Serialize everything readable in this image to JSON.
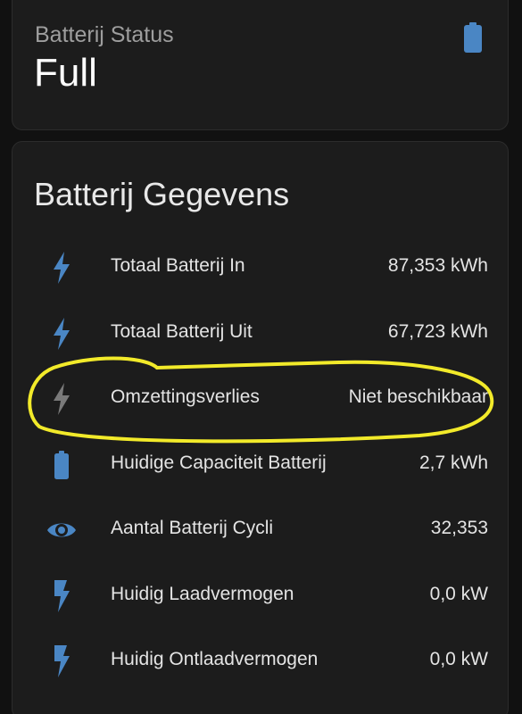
{
  "status_card": {
    "label": "Batterij Status",
    "value": "Full",
    "icon": "battery-icon"
  },
  "details": {
    "title": "Batterij Gegevens",
    "rows": [
      {
        "icon": "lightning-bolt-icon",
        "label": "Totaal Batterij In",
        "value": "87,353 kWh"
      },
      {
        "icon": "lightning-bolt-icon",
        "label": "Totaal Batterij Uit",
        "value": "67,723 kWh"
      },
      {
        "icon": "lightning-bolt-icon",
        "label": "Omzettingsverlies",
        "value": "Niet beschikbaar"
      },
      {
        "icon": "battery-icon",
        "label": "Huidige Capaciteit Batterij",
        "value": "2,7 kWh"
      },
      {
        "icon": "eye-icon",
        "label": "Aantal Batterij Cycli",
        "value": "32,353"
      },
      {
        "icon": "flash-icon",
        "label": "Huidig Laadvermogen",
        "value": "0,0 kW"
      },
      {
        "icon": "flash-icon",
        "label": "Huidig Ontlaadvermogen",
        "value": "0,0 kW"
      }
    ]
  },
  "colors": {
    "icon_active": "#4a86c4",
    "icon_unavailable": "#7a7a7a",
    "highlight_stroke": "#f2ea2a"
  }
}
